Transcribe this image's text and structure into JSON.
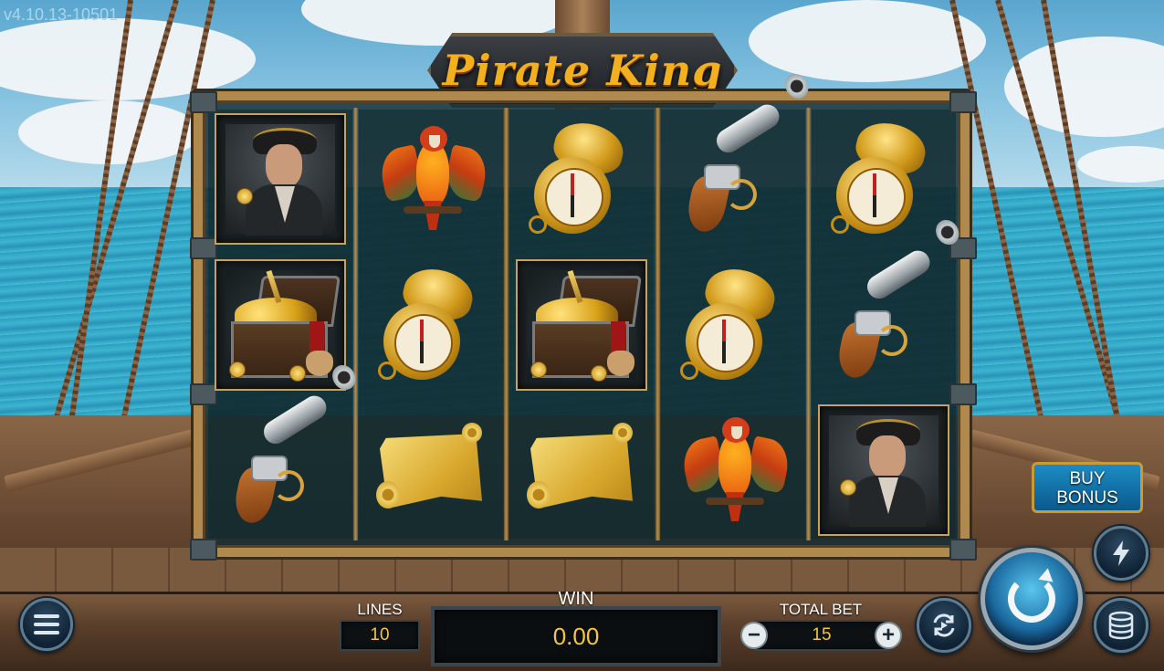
{
  "version": "v4.10.13-10501",
  "game": {
    "title": "Pirate King"
  },
  "reels": [
    [
      "pirate",
      "treasure-chest",
      "pistol"
    ],
    [
      "parrot",
      "compass",
      "treasure-map"
    ],
    [
      "compass",
      "treasure-chest",
      "treasure-map"
    ],
    [
      "pistol",
      "compass",
      "parrot"
    ],
    [
      "compass",
      "pistol",
      "pirate"
    ]
  ],
  "controls": {
    "lines_label": "LINES",
    "lines_value": "10",
    "win_label": "WIN",
    "win_value": "0.00",
    "total_bet_label": "TOTAL BET",
    "total_bet_value": "15",
    "minus_symbol": "−",
    "plus_symbol": "+",
    "buy_bonus_line1": "BUY",
    "buy_bonus_line2": "BONUS"
  },
  "colors": {
    "accent_gold": "#f3c63c",
    "buy_bonus_blue": "#1c8cc4",
    "frame_gold": "#b0894f"
  },
  "icons": {
    "menu": "menu-icon",
    "turbo": "lightning-icon",
    "autoplay": "autoplay-icon",
    "spin": "spin-icon",
    "coins": "coin-stack-icon"
  }
}
